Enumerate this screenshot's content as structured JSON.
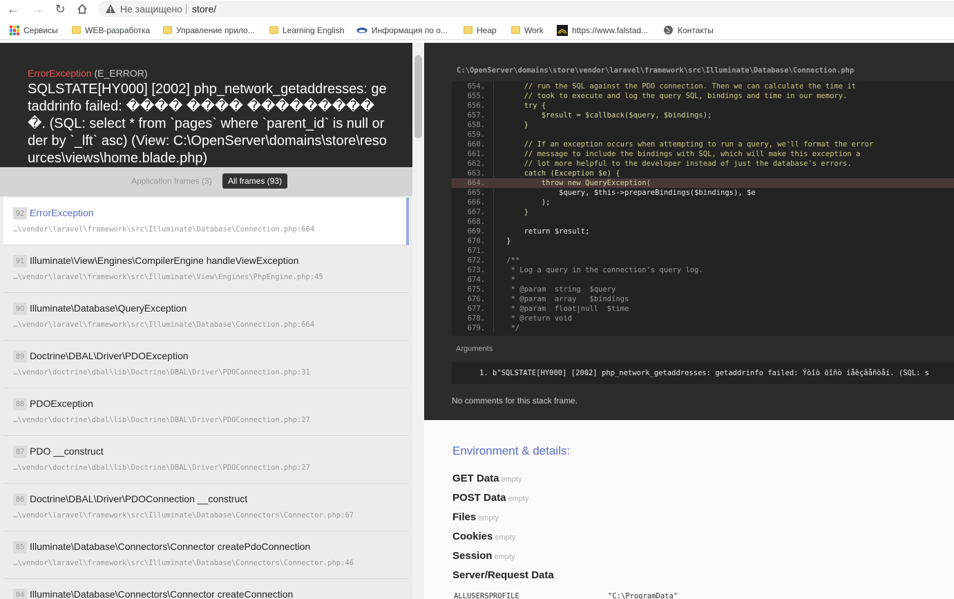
{
  "browser": {
    "security_label": "Не защищено",
    "url": "store/",
    "bookmarks": [
      {
        "label": "Сервисы",
        "icon": "apps-grid-icon"
      },
      {
        "label": "WEB-разработка",
        "icon": "folder-icon"
      },
      {
        "label": "Управление прило...",
        "icon": "folder-icon"
      },
      {
        "label": "Learning English",
        "icon": "folder-icon"
      },
      {
        "label": "Информация по о...",
        "icon": "site-icon"
      },
      {
        "label": "Heap",
        "icon": "folder-icon"
      },
      {
        "label": "Work",
        "icon": "folder-icon"
      },
      {
        "label": "https://www.falstad...",
        "icon": "site-icon"
      },
      {
        "label": "Контакты",
        "icon": "globe-icon"
      }
    ]
  },
  "exception": {
    "class": "ErrorException",
    "severity": "(E_ERROR)",
    "message": "SQLSTATE[HY000] [2002] php_network_getaddresses: getaddrinfo failed: ���� ���� ����������. (SQL: select * from `pages` where `parent_id` is null order by `_lft` asc) (View: C:\\OpenServer\\domains\\store\\resources\\views\\home.blade.php)"
  },
  "filters": {
    "application": "Application frames (3)",
    "all": "All frames (93)"
  },
  "frames": [
    {
      "index": "92",
      "class": "ErrorException",
      "file": "…\\vendor\\laravel\\framework\\src\\Illuminate\\Database\\Connection.php:664"
    },
    {
      "index": "91",
      "class": "Illuminate\\View\\Engines\\CompilerEngine handleViewException",
      "file": "…\\vendor\\laravel\\framework\\src\\Illuminate\\View\\Engines\\PhpEngine.php:45"
    },
    {
      "index": "90",
      "class": "Illuminate\\Database\\QueryException",
      "file": "…\\vendor\\laravel\\framework\\src\\Illuminate\\Database\\Connection.php:664"
    },
    {
      "index": "89",
      "class": "Doctrine\\DBAL\\Driver\\PDOException",
      "file": "…\\vendor\\doctrine\\dbal\\lib\\Doctrine\\DBAL\\Driver\\PDOConnection.php:31"
    },
    {
      "index": "88",
      "class": "PDOException",
      "file": "…\\vendor\\doctrine\\dbal\\lib\\Doctrine\\DBAL\\Driver\\PDOConnection.php:27"
    },
    {
      "index": "87",
      "class": "PDO __construct",
      "file": "…\\vendor\\doctrine\\dbal\\lib\\Doctrine\\DBAL\\Driver\\PDOConnection.php:27"
    },
    {
      "index": "86",
      "class": "Doctrine\\DBAL\\Driver\\PDOConnection __construct",
      "file": "…\\vendor\\laravel\\framework\\src\\Illuminate\\Database\\Connectors\\Connector.php:67"
    },
    {
      "index": "85",
      "class": "Illuminate\\Database\\Connectors\\Connector createPdoConnection",
      "file": "…\\vendor\\laravel\\framework\\src\\Illuminate\\Database\\Connectors\\Connector.php:46"
    },
    {
      "index": "84",
      "class": "Illuminate\\Database\\Connectors\\Connector createConnection",
      "file": ""
    }
  ],
  "code": {
    "file_path": "C:\\OpenServer\\domains\\store\\vendor\\laravel\\framework\\src\\Illuminate\\Database\\Connection.php",
    "lines": [
      {
        "n": "654.",
        "t": "        // run the SQL against the PDO connection. Then we can calculate the time it",
        "k": "comment"
      },
      {
        "n": "655.",
        "t": "        // took to execute and log the query SQL, bindings and time in our memory.",
        "k": "comment"
      },
      {
        "n": "656.",
        "t": "        try {",
        "k": "code"
      },
      {
        "n": "657.",
        "t": "            $result = $callback($query, $bindings);",
        "k": "code"
      },
      {
        "n": "658.",
        "t": "        }",
        "k": "code"
      },
      {
        "n": "659.",
        "t": "",
        "k": "code"
      },
      {
        "n": "660.",
        "t": "        // If an exception occurs when attempting to run a query, we'll format the error",
        "k": "comment"
      },
      {
        "n": "661.",
        "t": "        // message to include the bindings with SQL, which will make this exception a",
        "k": "comment"
      },
      {
        "n": "662.",
        "t": "        // lot more helpful to the developer instead of just the database's errors.",
        "k": "comment"
      },
      {
        "n": "663.",
        "t": "        catch (Exception $e) {",
        "k": "code"
      },
      {
        "n": "664.",
        "t": "            throw new QueryException(",
        "k": "code",
        "highlight": true
      },
      {
        "n": "665.",
        "t": "                $query, $this->prepareBindings($bindings), $e",
        "k": "plain"
      },
      {
        "n": "666.",
        "t": "            );",
        "k": "plain"
      },
      {
        "n": "667.",
        "t": "        }",
        "k": "code"
      },
      {
        "n": "668.",
        "t": "",
        "k": "code"
      },
      {
        "n": "669.",
        "t": "        return $result;",
        "k": "plain"
      },
      {
        "n": "670.",
        "t": "    }",
        "k": "plain"
      },
      {
        "n": "671.",
        "t": "",
        "k": "code"
      },
      {
        "n": "672.",
        "t": "    /**",
        "k": "doc"
      },
      {
        "n": "673.",
        "t": "     * Log a query in the connection's query log.",
        "k": "doc"
      },
      {
        "n": "674.",
        "t": "     *",
        "k": "doc"
      },
      {
        "n": "675.",
        "t": "     * @param  string  $query",
        "k": "doc"
      },
      {
        "n": "676.",
        "t": "     * @param  array   $bindings",
        "k": "doc"
      },
      {
        "n": "677.",
        "t": "     * @param  float|null  $time",
        "k": "doc"
      },
      {
        "n": "678.",
        "t": "     * @return void",
        "k": "doc"
      },
      {
        "n": "679.",
        "t": "     */",
        "k": "doc"
      }
    ]
  },
  "arguments": {
    "title": "Arguments",
    "items": [
      "1. b\"SQLSTATE[HY000] [2002] php_network_getaddresses: getaddrinfo failed: Ýòîò õîñò íåèçâåñòåí.  (SQL: s"
    ]
  },
  "no_comments": "No comments for this stack frame.",
  "environment": {
    "title": "Environment & details:",
    "sections": [
      {
        "label": "GET Data",
        "note": "empty"
      },
      {
        "label": "POST Data",
        "note": "empty"
      },
      {
        "label": "Files",
        "note": "empty"
      },
      {
        "label": "Cookies",
        "note": "empty"
      },
      {
        "label": "Session",
        "note": "empty"
      },
      {
        "label": "Server/Request Data",
        "note": ""
      }
    ],
    "server_row": {
      "key": "ALLUSERSPROFILE",
      "value": "\"C:\\ProgramData\""
    }
  }
}
